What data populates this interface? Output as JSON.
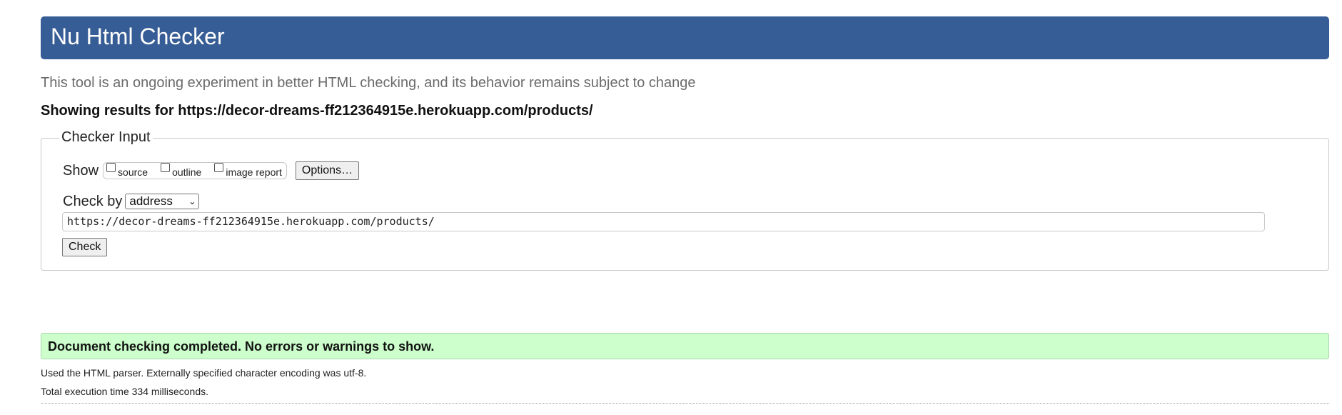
{
  "header": {
    "title": "Nu Html Checker",
    "bg_color": "#365d95"
  },
  "subtitle": "This tool is an ongoing experiment in better HTML checking, and its behavior remains subject to change",
  "showing": {
    "label": "Showing results for",
    "url": "https://decor-dreams-ff212364915e.herokuapp.com/products/"
  },
  "checker_input": {
    "legend": "Checker Input",
    "show_label": "Show",
    "checkboxes": [
      {
        "label": "source",
        "checked": false
      },
      {
        "label": "outline",
        "checked": false
      },
      {
        "label": "image report",
        "checked": false
      }
    ],
    "options_button": "Options…",
    "check_by_label": "Check by",
    "check_by_selected": "address",
    "url_value": "https://decor-dreams-ff212364915e.herokuapp.com/products/",
    "check_button": "Check"
  },
  "result": {
    "message": "Document checking completed. No errors or warnings to show.",
    "bg_color": "#ccffcc"
  },
  "details": {
    "parser": "Used the HTML parser. Externally specified character encoding was utf-8.",
    "time": "Total execution time 334 milliseconds."
  }
}
